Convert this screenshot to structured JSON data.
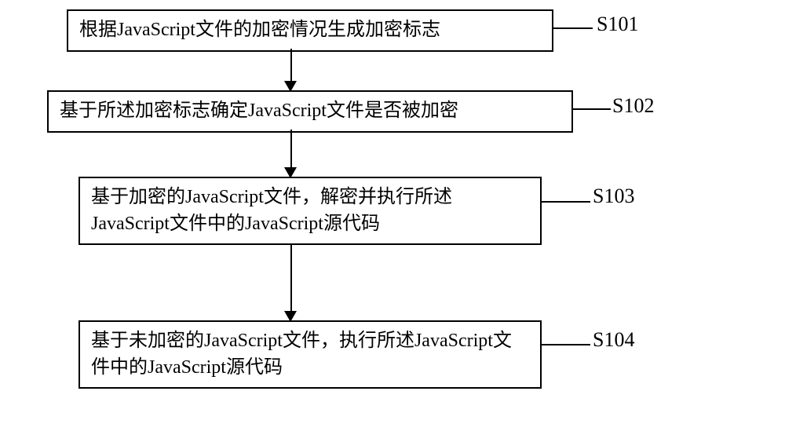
{
  "steps": [
    {
      "text": "根据JavaScript文件的加密情况生成加密标志",
      "label": "S101"
    },
    {
      "text": "基于所述加密标志确定JavaScript文件是否被加密",
      "label": "S102"
    },
    {
      "text": "基于加密的JavaScript文件，解密并执行所述JavaScript文件中的JavaScript源代码",
      "label": "S103"
    },
    {
      "text": "基于未加密的JavaScript文件，执行所述JavaScript文件中的JavaScript源代码",
      "label": "S104"
    }
  ]
}
